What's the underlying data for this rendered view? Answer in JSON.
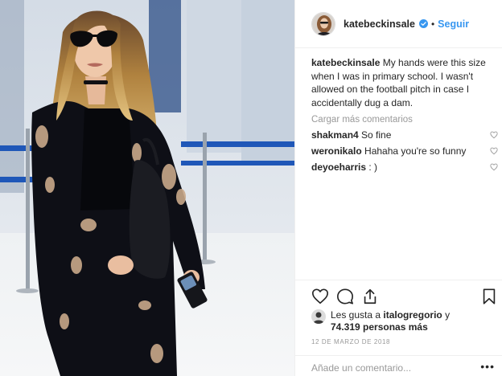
{
  "post": {
    "username": "katebeckinsale",
    "follow_label": "Seguir",
    "separator": "•",
    "caption": {
      "username": "katebeckinsale",
      "text": " My hands were this size when I was in primary school. I wasn't allowed on the football pitch in case I accidentally dug a dam."
    },
    "load_more_label": "Cargar más comentarios",
    "comments": [
      {
        "username": "shakman4",
        "text": " So fine"
      },
      {
        "username": "weronikalo",
        "text": " Hahaha you're so funny"
      },
      {
        "username": "deyoeharris",
        "text": " : )"
      }
    ],
    "likes": {
      "prefix": "Les gusta a ",
      "liked_by": "italogregorio",
      "middle": " y ",
      "count": "74.319 personas más"
    },
    "date": "12 DE MARZO DE 2018",
    "add_comment_placeholder": "Añade un comentario...",
    "more_label": "•••"
  },
  "icons": {
    "verified": "verified-badge-icon",
    "heart": "heart-icon",
    "comment": "comment-icon",
    "share": "share-icon",
    "bookmark": "bookmark-icon",
    "more": "more-options-icon"
  },
  "colors": {
    "accent": "#3897f0",
    "text": "#262626",
    "muted": "#999999",
    "border": "#efefef"
  }
}
